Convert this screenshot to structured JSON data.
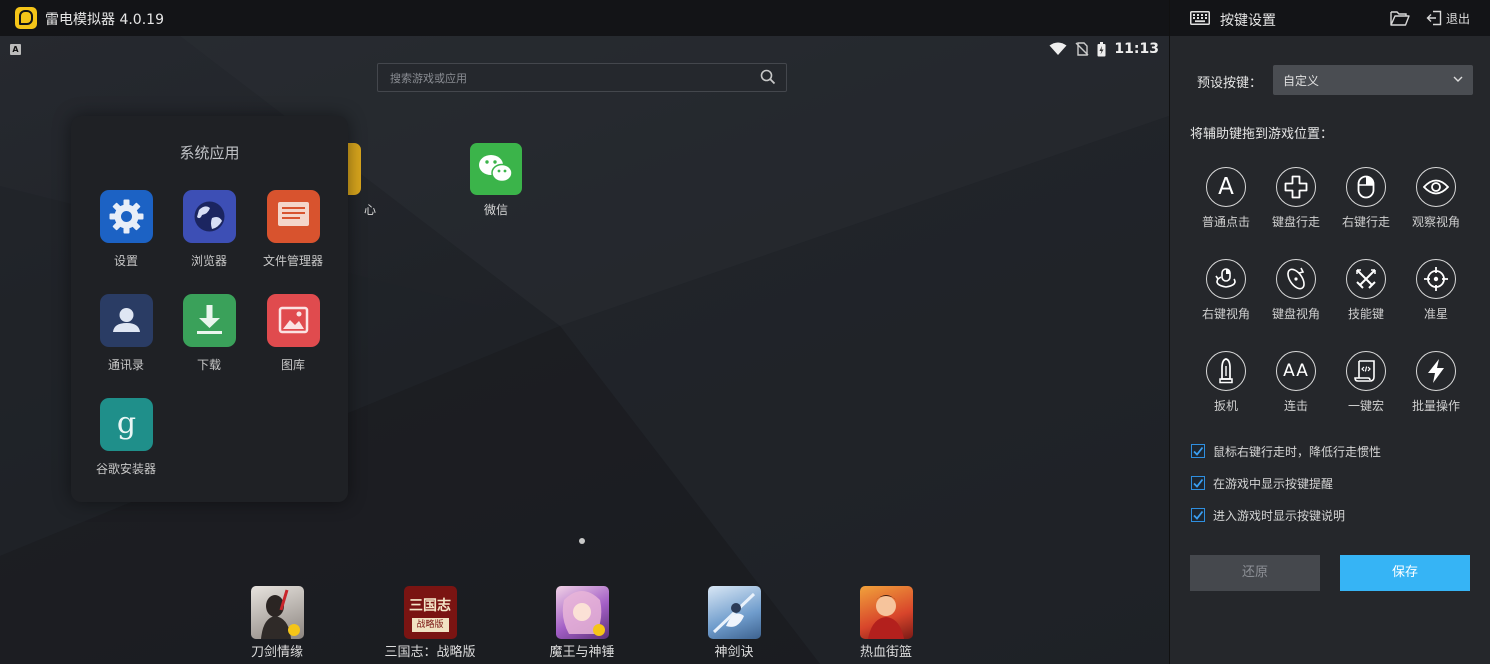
{
  "titlebar": {
    "title": "雷电模拟器 4.0.19"
  },
  "statusbar": {
    "keyboard_indicator": "A",
    "time": "11:13"
  },
  "search": {
    "placeholder": "搜索游戏或应用"
  },
  "home": {
    "apps": [
      {
        "label": "心",
        "icon": "partial-app-icon"
      },
      {
        "label": "微信",
        "icon": "wechat-icon"
      }
    ]
  },
  "folder": {
    "title": "系统应用",
    "apps": [
      {
        "label": "设置",
        "icon": "gear-icon",
        "color": "#1c62c4"
      },
      {
        "label": "浏览器",
        "icon": "globe-icon",
        "color": "#3d4fb5"
      },
      {
        "label": "文件管理器",
        "icon": "file-manager-icon",
        "color": "#d8532e"
      },
      {
        "label": "通讯录",
        "icon": "contacts-icon",
        "color": "#2a3c64"
      },
      {
        "label": "下载",
        "icon": "download-icon",
        "color": "#3aa15a"
      },
      {
        "label": "图库",
        "icon": "gallery-icon",
        "color": "#e04b4e"
      },
      {
        "label": "谷歌安装器",
        "icon": "google-installer-icon",
        "color": "#1f8f8a"
      }
    ]
  },
  "dock": {
    "apps": [
      {
        "label": "刀剑情缘",
        "icon": "dao-jian-qing-yuan-icon"
      },
      {
        "label": "三国志：战略版",
        "icon": "san-guo-zhi-icon",
        "badge_text": "三国志",
        "badge_sub": "战略版"
      },
      {
        "label": "魔王与神锤",
        "icon": "mo-wang-yu-shen-chui-icon"
      },
      {
        "label": "神剑诀",
        "icon": "shen-jian-jue-icon"
      },
      {
        "label": "热血街篮",
        "icon": "re-xue-jie-lan-icon"
      }
    ]
  },
  "panel": {
    "title": "按键设置",
    "exit_label": "退出",
    "preset_label": "预设按键：",
    "preset_value": "自定义",
    "drag_hint": "将辅助键拖到游戏位置：",
    "tools": [
      {
        "label": "普通点击",
        "icon": "letter-a-icon",
        "glyph": "A"
      },
      {
        "label": "键盘行走",
        "icon": "dpad-icon"
      },
      {
        "label": "右键行走",
        "icon": "mouse-icon"
      },
      {
        "label": "观察视角",
        "icon": "eye-icon"
      },
      {
        "label": "右键视角",
        "icon": "mouse-rotate-icon"
      },
      {
        "label": "键盘视角",
        "icon": "rotate-view-icon"
      },
      {
        "label": "技能键",
        "icon": "crossed-swords-icon"
      },
      {
        "label": "准星",
        "icon": "crosshair-icon"
      },
      {
        "label": "扳机",
        "icon": "bullet-icon"
      },
      {
        "label": "连击",
        "icon": "double-a-icon",
        "glyph": "AA"
      },
      {
        "label": "一键宏",
        "icon": "macro-script-icon"
      },
      {
        "label": "批量操作",
        "icon": "lightning-icon"
      }
    ],
    "options": [
      {
        "label": "鼠标右键行走时，降低行走惯性",
        "checked": true
      },
      {
        "label": "在游戏中显示按键提醒",
        "checked": true
      },
      {
        "label": "进入游戏时显示按键说明",
        "checked": true
      }
    ],
    "reset_label": "还原",
    "save_label": "保存",
    "accent_color": "#36b4f5"
  }
}
